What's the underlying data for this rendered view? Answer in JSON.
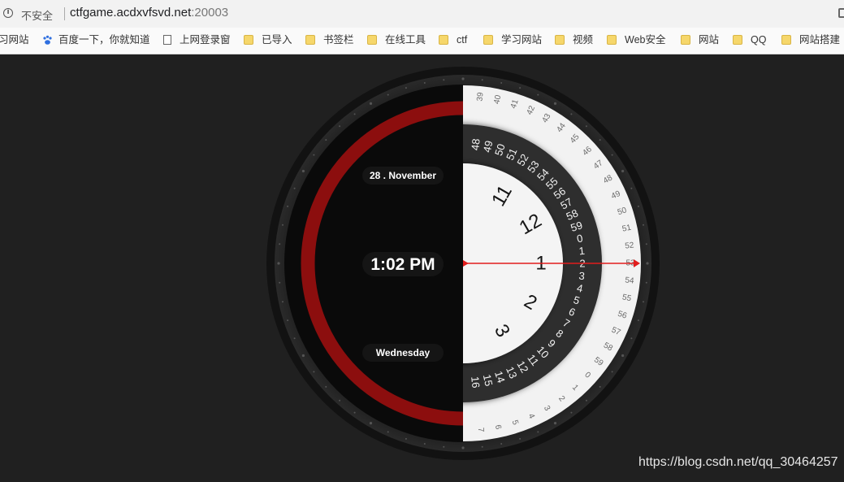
{
  "browser": {
    "security_label": "不安全",
    "url_host": "ctfgame.acdxvfsvd.net",
    "url_port": ":20003",
    "bookmarks": [
      {
        "label": "习网站",
        "icon": "none"
      },
      {
        "label": "百度一下，你就知道",
        "icon": "baidu-paw-icon"
      },
      {
        "label": "上网登录窗",
        "icon": "page-icon"
      },
      {
        "label": "已导入",
        "icon": "folder-icon"
      },
      {
        "label": "书签栏",
        "icon": "folder-icon"
      },
      {
        "label": "在线工具",
        "icon": "folder-icon"
      },
      {
        "label": "ctf",
        "icon": "folder-icon"
      },
      {
        "label": "学习网站",
        "icon": "folder-icon"
      },
      {
        "label": "视频",
        "icon": "folder-icon"
      },
      {
        "label": "Web安全",
        "icon": "folder-icon"
      },
      {
        "label": "网站",
        "icon": "folder-icon"
      },
      {
        "label": "QQ",
        "icon": "folder-icon"
      },
      {
        "label": "网站搭建",
        "icon": "folder-icon"
      }
    ]
  },
  "clock": {
    "date": "28 . November",
    "time": "1:02 PM",
    "day": "Wednesday",
    "hour_labels": [
      "11",
      "12",
      "1",
      "2",
      "3"
    ],
    "minute_labels": [
      "48",
      "49",
      "50",
      "51",
      "52",
      "53",
      "54",
      "55",
      "56",
      "57",
      "58",
      "59",
      "0",
      "1",
      "2",
      "3",
      "4",
      "5",
      "6",
      "7",
      "8",
      "9",
      "10",
      "11",
      "12",
      "13",
      "14",
      "15",
      "16"
    ],
    "second_labels": [
      "39",
      "40",
      "41",
      "42",
      "43",
      "44",
      "45",
      "46",
      "47",
      "48",
      "49",
      "50",
      "51",
      "52",
      "53",
      "54",
      "55",
      "56",
      "57",
      "58",
      "59",
      "0",
      "1",
      "2",
      "3",
      "4",
      "5",
      "6",
      "7"
    ]
  },
  "colors": {
    "accent_red": "#8c0e0e",
    "indicator_red": "#e11d1d",
    "dial_white": "#f2f2f2",
    "dial_dark": "#2d2d2d"
  },
  "watermark": "https://blog.csdn.net/qq_30464257"
}
